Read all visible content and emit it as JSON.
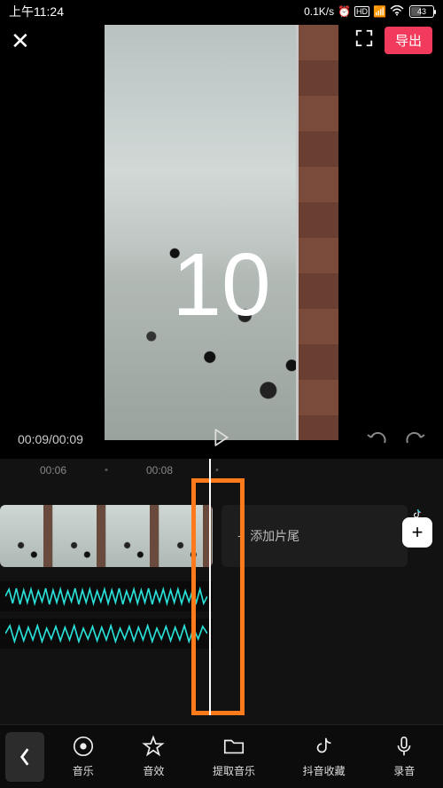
{
  "status": {
    "time": "上午11:24",
    "net_speed": "0.1K/s",
    "battery_pct": "43"
  },
  "header": {
    "export_label": "导出"
  },
  "preview": {
    "overlay_number": "10",
    "time_current": "00:09",
    "time_total": "00:09"
  },
  "timeline": {
    "ticks": [
      "00:06",
      "00:08"
    ],
    "add_ending_label": "添加片尾"
  },
  "toolbar": {
    "items": [
      {
        "key": "music",
        "label": "音乐"
      },
      {
        "key": "sfx",
        "label": "音效"
      },
      {
        "key": "extract",
        "label": "提取音乐"
      },
      {
        "key": "douyin",
        "label": "抖音收藏"
      },
      {
        "key": "record",
        "label": "录音"
      }
    ]
  }
}
